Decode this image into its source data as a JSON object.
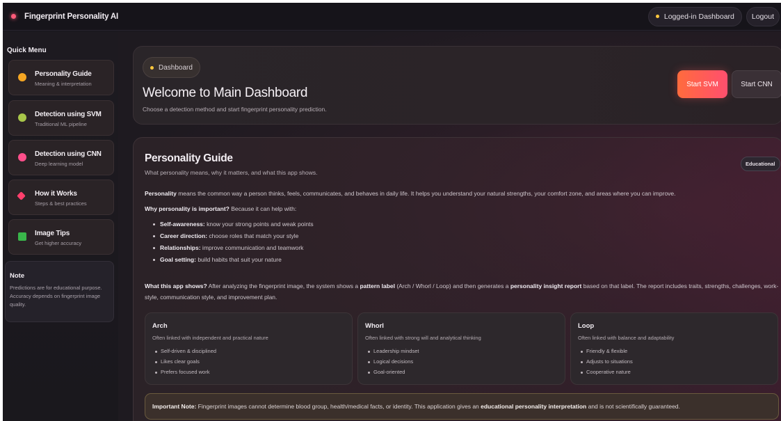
{
  "app": {
    "title": "Fingerprint Personality AI"
  },
  "topbar": {
    "status_label": "Logged-in Dashboard",
    "logout_label": "Logout"
  },
  "sidebar": {
    "title": "Quick Menu",
    "items": [
      {
        "label": "Personality Guide",
        "sub": "Meaning & interpretation",
        "icon": "brain-icon",
        "color": "#f5a623"
      },
      {
        "label": "Detection using SVM",
        "sub": "Traditional ML pipeline",
        "icon": "gear-icon",
        "color": "#a8c64a"
      },
      {
        "label": "Detection using CNN",
        "sub": "Deep learning model",
        "icon": "neural-icon",
        "color": "#ff4f8b"
      },
      {
        "label": "How it Works",
        "sub": "Steps & best practices",
        "icon": "book-icon",
        "color": "#ff3f6c"
      },
      {
        "label": "Image Tips",
        "sub": "Get higher accuracy",
        "icon": "check-icon",
        "color": "#39b54a"
      }
    ],
    "note": {
      "title": "Note",
      "body": "Predictions are for educational purpose. Accuracy depends on fingerprint image quality."
    }
  },
  "dashboard": {
    "crumb": "Dashboard",
    "title": "Welcome to Main Dashboard",
    "subtitle": "Choose a detection method and start fingerprint personality prediction.",
    "btn_svm": "Start SVM",
    "btn_cnn": "Start CNN"
  },
  "guide": {
    "title": "Personality Guide",
    "subtitle": "What personality means, why it matters, and what this app shows.",
    "badge": "Educational",
    "p1_bold": "Personality",
    "p1_rest": " means the common way a person thinks, feels, communicates, and behaves in daily life. It helps you understand your natural strengths, your comfort zone, and areas where you can improve.",
    "p2_bold": "Why personality is important?",
    "p2_rest": " Because it can help with:",
    "bullets": [
      {
        "b": "Self-awareness:",
        "t": " know your strong points and weak points"
      },
      {
        "b": "Career direction:",
        "t": " choose roles that match your style"
      },
      {
        "b": "Relationships:",
        "t": " improve communication and teamwork"
      },
      {
        "b": "Goal setting:",
        "t": " build habits that suit your nature"
      }
    ],
    "p3_b1": "What this app shows?",
    "p3_t1": " After analyzing the fingerprint image, the system shows a ",
    "p3_b2": "pattern label",
    "p3_t2": " (Arch / Whorl / Loop) and then generates a ",
    "p3_b3": "personality insight report",
    "p3_t3": " based on that label. The report includes traits, strengths, challenges, work-style, communication style, and improvement plan.",
    "cards": [
      {
        "title": "Arch",
        "sub": "Often linked with independent and practical nature",
        "items": [
          "Self-driven & disciplined",
          "Likes clear goals",
          "Prefers focused work"
        ]
      },
      {
        "title": "Whorl",
        "sub": "Often linked with strong will and analytical thinking",
        "items": [
          "Leadership mindset",
          "Logical decisions",
          "Goal-oriented"
        ]
      },
      {
        "title": "Loop",
        "sub": "Often linked with balance and adaptability",
        "items": [
          "Friendly & flexible",
          "Adjusts to situations",
          "Cooperative nature"
        ]
      }
    ],
    "note_b1": "Important Note:",
    "note_t1": " Fingerprint images cannot determine blood group, health/medical facts, or identity. This application gives an ",
    "note_b2": "educational personality interpretation",
    "note_t2": " and is not scientifically guaranteed."
  }
}
